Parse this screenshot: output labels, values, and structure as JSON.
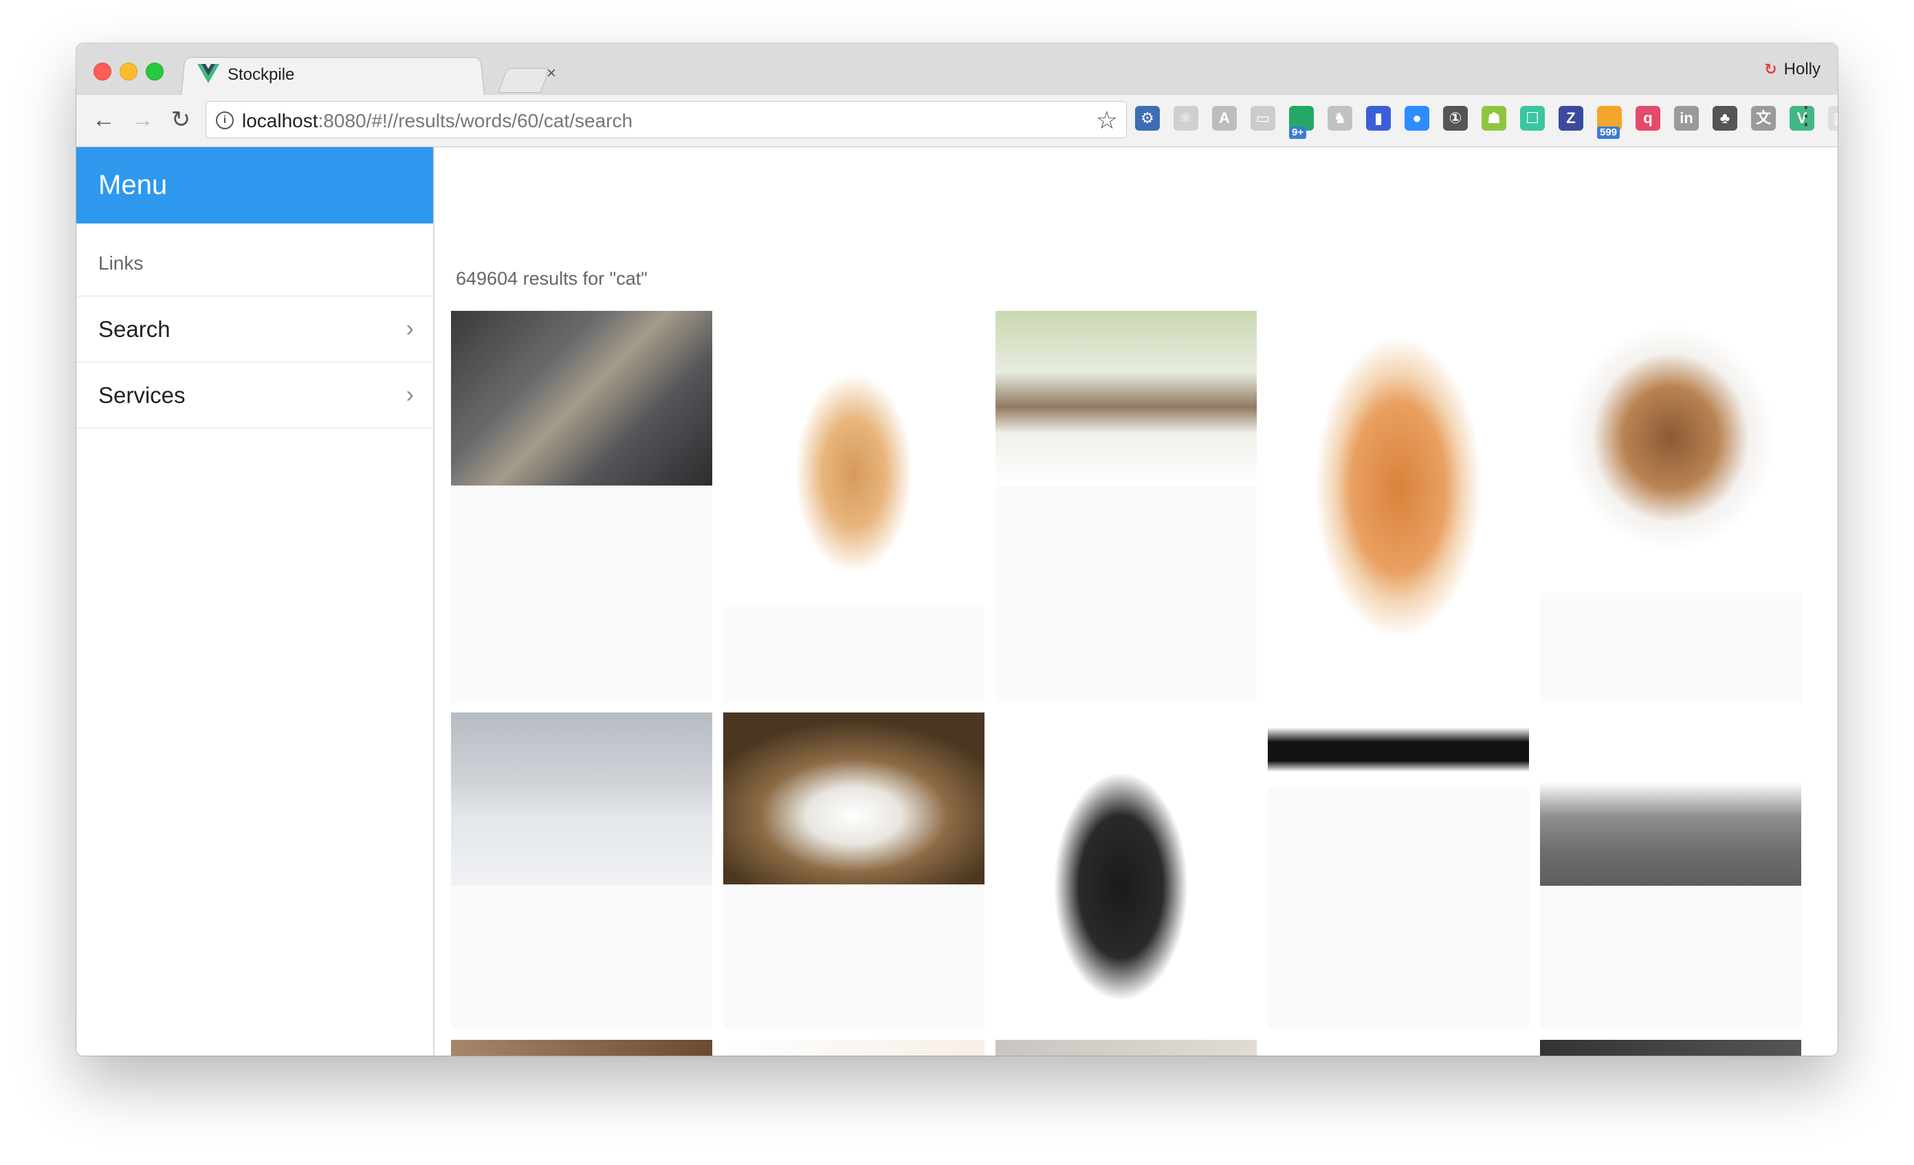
{
  "browser": {
    "tab_title": "Stockpile",
    "tab_close": "×",
    "profile_name": "Holly",
    "url_host": "localhost",
    "url_rest": ":8080/#!//results/words/60/cat/search",
    "info_glyph": "i",
    "back": "←",
    "forward": "→",
    "reload": "↻",
    "bookmark": "☆",
    "more": "⋮",
    "extensions": [
      {
        "name": "gear-extension-icon",
        "color": "#3d6db3",
        "glyph": "⚙"
      },
      {
        "name": "react-extension-icon",
        "color": "#cfcfcf",
        "glyph": "⚛"
      },
      {
        "name": "angular-extension-icon",
        "color": "#bdbdbd",
        "glyph": "A"
      },
      {
        "name": "cast-extension-icon",
        "color": "#cccccc",
        "glyph": "▭"
      },
      {
        "name": "grammar-extension-icon",
        "color": "#24a867",
        "glyph": "",
        "badge": "9+"
      },
      {
        "name": "rabbit-extension-icon",
        "color": "#c2c2c2",
        "glyph": "♞"
      },
      {
        "name": "window-resizer-icon",
        "color": "#3b5fd9",
        "glyph": "▮"
      },
      {
        "name": "zoom-extension-icon",
        "color": "#2d8cff",
        "glyph": "●"
      },
      {
        "name": "onepassword-icon",
        "color": "#555555",
        "glyph": "①"
      },
      {
        "name": "android-extension-icon",
        "color": "#8ec63f",
        "glyph": "☗"
      },
      {
        "name": "tabs-extension-icon",
        "color": "#39c6a0",
        "glyph": "☐"
      },
      {
        "name": "z-extension-icon",
        "color": "#3b4a9e",
        "glyph": "Z"
      },
      {
        "name": "rss-extension-icon",
        "color": "#f4a62a",
        "glyph": "",
        "badge": "599"
      },
      {
        "name": "quote-extension-icon",
        "color": "#e44a6a",
        "glyph": "q"
      },
      {
        "name": "linkedin-extension-icon",
        "color": "#9a9a9a",
        "glyph": "in"
      },
      {
        "name": "evernote-extension-icon",
        "color": "#555555",
        "glyph": "♣"
      },
      {
        "name": "translate-extension-icon",
        "color": "#9a9a9a",
        "glyph": "文"
      },
      {
        "name": "vue-devtools-icon",
        "color": "#41b883",
        "glyph": "V"
      },
      {
        "name": "chart-extension-icon",
        "color": "#dedede",
        "glyph": "▥"
      }
    ]
  },
  "sidebar": {
    "title": "Menu",
    "section": "Links",
    "items": [
      {
        "label": "Search",
        "chevron": "›"
      },
      {
        "label": "Services",
        "chevron": "›"
      }
    ]
  },
  "results": {
    "count_text": "649604 results for \"cat\""
  },
  "images": [
    {
      "name": "kitten-looking-up-photo",
      "bg": "linear-gradient(135deg,#3a3a3c 0%,#6b6b6e 35%,#a59b8a 50%,#55565a 70%,#2c2c2e 100%)"
    },
    {
      "name": "ginger-kitten-pawing-photo",
      "bg": "radial-gradient(ellipse 30% 45% at 50% 55%,#d69a5a 0%,#e8b57c 40%,#ffffff 75%)"
    },
    {
      "name": "sleeping-tabby-kitten-photo",
      "bg": "linear-gradient(180deg,#c9d8b0 0%,#e8ebe0 35%,#8f7a60 55%,#f1efe9 70%,#ffffff 100%)"
    },
    {
      "name": "orange-white-cat-walking-photo",
      "bg": "radial-gradient(ellipse 40% 48% at 50% 45%,#d9823a 0%,#e9a061 45%,#f3d4b2 60%,#ffffff 80%)"
    },
    {
      "name": "cat-tearing-paper-photo",
      "bg": "radial-gradient(ellipse 40% 40% at 50% 45%,#8a5a35 0%,#b98352 45%,#f4f1ee 75%,#ffffff 100%)"
    },
    {
      "name": "grey-kitten-on-sofa-photo",
      "bg": "linear-gradient(180deg,#b7bcc3 0%,#cfd3d8 40%,#e3e6ea 60%,#f0f2f4 100%)"
    },
    {
      "name": "cat-face-closeup-photo",
      "bg": "radial-gradient(ellipse 60% 55% at 50% 60%,#ffffff 0%,#e9e6e0 30%,#8c6b45 60%,#4a3722 100%)"
    },
    {
      "name": "black-white-cat-sitting-photo",
      "bg": "radial-gradient(ellipse 32% 45% at 48% 55%,#1a1a1a 0%,#2a2a2a 50%,#ffffff 80%)"
    },
    {
      "name": "cat-silhouettes-photo",
      "bg": "linear-gradient(180deg,#ffffff 0%,#ffffff 20%,#111111 40%,#111111 65%,#ffffff 80%)"
    },
    {
      "name": "grey-cat-peeking-photo",
      "bg": "linear-gradient(180deg,#ffffff 0%,#ffffff 40%,#8e8e8e 60%,#6e6e6e 80%,#5e5e5e 100%)"
    },
    {
      "name": "row3-photo-1",
      "bg": "linear-gradient(90deg,#a8866a,#6b4a30)"
    },
    {
      "name": "row3-photo-2",
      "bg": "linear-gradient(90deg,#ffffff,#f6efe6)"
    },
    {
      "name": "row3-photo-3",
      "bg": "linear-gradient(90deg,#c9c5c0,#e0dcd5)"
    },
    {
      "name": "row3-photo-4",
      "bg": "linear-gradient(90deg,#ffffff,#ffffff)"
    },
    {
      "name": "row3-photo-5",
      "bg": "linear-gradient(90deg,#333333,#555555)"
    }
  ]
}
